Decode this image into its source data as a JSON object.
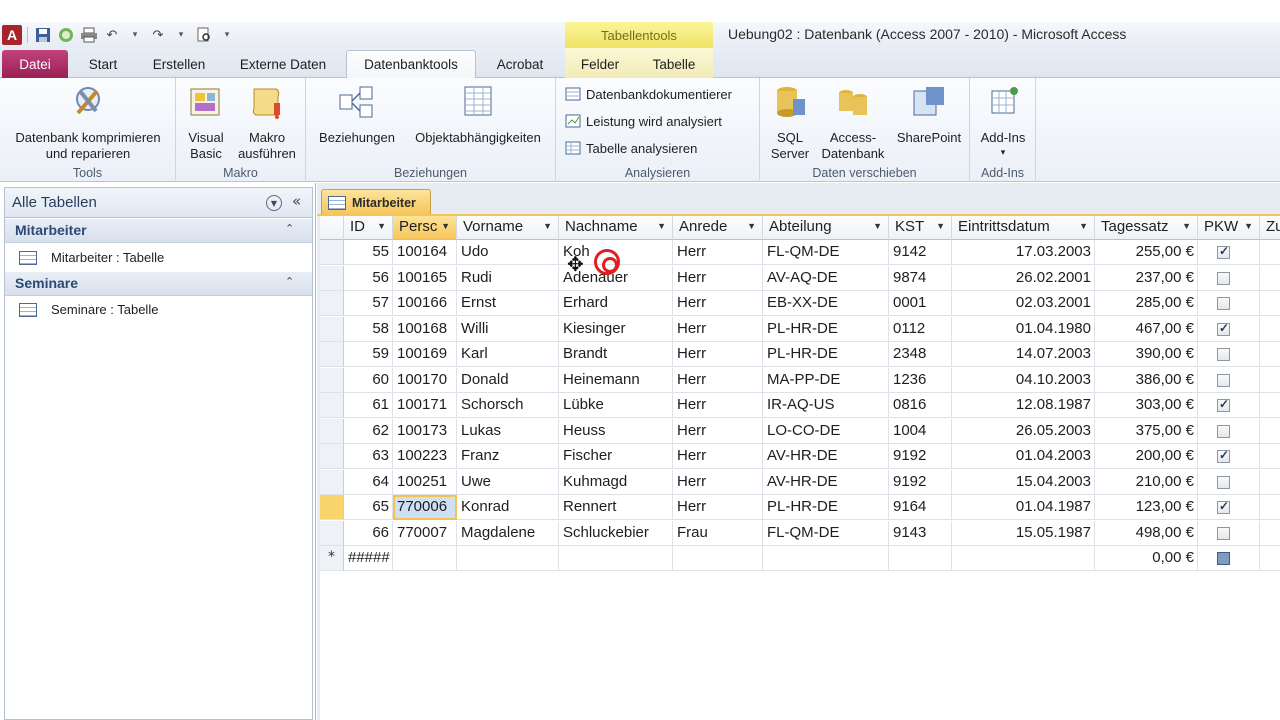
{
  "title_bar": {
    "window_title": "Uebung02 : Datenbank (Access 2007 - 2010)  -  Microsoft Access",
    "contextual_tools": "Tabellentools",
    "app_icon": "A"
  },
  "tabs": [
    "Datei",
    "Start",
    "Erstellen",
    "Externe Daten",
    "Datenbanktools",
    "Acrobat",
    "Felder",
    "Tabelle"
  ],
  "active_tab": "Datenbanktools",
  "ribbon": {
    "tools": {
      "label": "Tools",
      "compact": "Datenbank komprimieren",
      "compact2": "und reparieren"
    },
    "makro": {
      "label": "Makro",
      "vb": "Visual",
      "vb2": "Basic",
      "run": "Makro",
      "run2": "ausführen"
    },
    "beziehungen": {
      "label": "Beziehungen",
      "rel": "Beziehungen",
      "dep": "Objektabhängigkeiten"
    },
    "analysieren": {
      "label": "Analysieren",
      "doc": "Datenbankdokumentierer",
      "perf": "Leistung wird analysiert",
      "tbl": "Tabelle analysieren"
    },
    "daten": {
      "label": "Daten verschieben",
      "sql": "SQL",
      "sql2": "Server",
      "acc": "Access-",
      "acc2": "Datenbank",
      "sp": "SharePoint"
    },
    "addins": {
      "label": "Add-Ins",
      "btn": "Add-Ins"
    }
  },
  "nav": {
    "header": "Alle Tabellen",
    "groups": [
      {
        "title": "Mitarbeiter",
        "item": "Mitarbeiter : Tabelle"
      },
      {
        "title": "Seminare",
        "item": "Seminare : Tabelle"
      }
    ]
  },
  "document_tab": "Mitarbeiter",
  "table": {
    "columns": [
      "ID",
      "Persc",
      "Vorname",
      "Nachname",
      "Anrede",
      "Abteilung",
      "KST",
      "Eintrittsdatum",
      "Tagessatz",
      "PKW",
      "Zu"
    ],
    "rows": [
      {
        "id": "55",
        "pers": "100164",
        "vorname": "Udo",
        "nachname": "Koh",
        "anrede": "Herr",
        "abt": "FL-QM-DE",
        "kst": "9142",
        "datum": "17.03.2003",
        "satz": "255,00 €",
        "pkw": true
      },
      {
        "id": "56",
        "pers": "100165",
        "vorname": "Rudi",
        "nachname": "Adenauer",
        "anrede": "Herr",
        "abt": "AV-AQ-DE",
        "kst": "9874",
        "datum": "26.02.2001",
        "satz": "237,00 €",
        "pkw": false
      },
      {
        "id": "57",
        "pers": "100166",
        "vorname": "Ernst",
        "nachname": "Erhard",
        "anrede": "Herr",
        "abt": "EB-XX-DE",
        "kst": "0001",
        "datum": "02.03.2001",
        "satz": "285,00 €",
        "pkw": false
      },
      {
        "id": "58",
        "pers": "100168",
        "vorname": "Willi",
        "nachname": "Kiesinger",
        "anrede": "Herr",
        "abt": "PL-HR-DE",
        "kst": "0112",
        "datum": "01.04.1980",
        "satz": "467,00 €",
        "pkw": true
      },
      {
        "id": "59",
        "pers": "100169",
        "vorname": "Karl",
        "nachname": "Brandt",
        "anrede": "Herr",
        "abt": "PL-HR-DE",
        "kst": "2348",
        "datum": "14.07.2003",
        "satz": "390,00 €",
        "pkw": false
      },
      {
        "id": "60",
        "pers": "100170",
        "vorname": "Donald",
        "nachname": "Heinemann",
        "anrede": "Herr",
        "abt": "MA-PP-DE",
        "kst": "1236",
        "datum": "04.10.2003",
        "satz": "386,00 €",
        "pkw": false
      },
      {
        "id": "61",
        "pers": "100171",
        "vorname": "Schorsch",
        "nachname": "Lübke",
        "anrede": "Herr",
        "abt": "IR-AQ-US",
        "kst": "0816",
        "datum": "12.08.1987",
        "satz": "303,00 €",
        "pkw": true
      },
      {
        "id": "62",
        "pers": "100173",
        "vorname": "Lukas",
        "nachname": "Heuss",
        "anrede": "Herr",
        "abt": "LO-CO-DE",
        "kst": "1004",
        "datum": "26.05.2003",
        "satz": "375,00 €",
        "pkw": false
      },
      {
        "id": "63",
        "pers": "100223",
        "vorname": "Franz",
        "nachname": "Fischer",
        "anrede": "Herr",
        "abt": "AV-HR-DE",
        "kst": "9192",
        "datum": "01.04.2003",
        "satz": "200,00 €",
        "pkw": true
      },
      {
        "id": "64",
        "pers": "100251",
        "vorname": "Uwe",
        "nachname": "Kuhmagd",
        "anrede": "Herr",
        "abt": "AV-HR-DE",
        "kst": "9192",
        "datum": "15.04.2003",
        "satz": "210,00 €",
        "pkw": false
      },
      {
        "id": "65",
        "pers": "770006",
        "vorname": "Konrad",
        "nachname": "Rennert",
        "anrede": "Herr",
        "abt": "PL-HR-DE",
        "kst": "9164",
        "datum": "01.04.1987",
        "satz": "123,00 €",
        "pkw": true
      },
      {
        "id": "66",
        "pers": "770007",
        "vorname": "Magdalene",
        "nachname": "Schluckebier",
        "anrede": "Frau",
        "abt": "FL-QM-DE",
        "kst": "9143",
        "datum": "15.05.1987",
        "satz": "498,00 €",
        "pkw": false
      }
    ],
    "new_row": {
      "marker": "*",
      "id": "#####",
      "satz": "0,00 €"
    },
    "current_row_id": "65"
  }
}
